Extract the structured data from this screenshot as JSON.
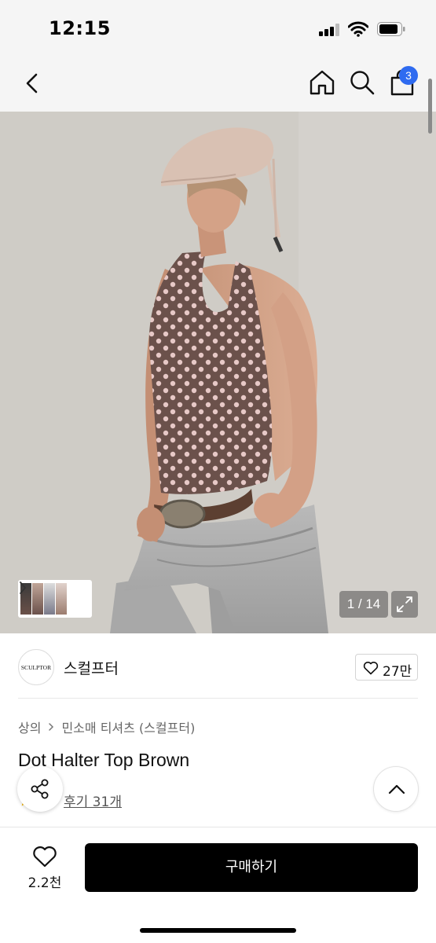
{
  "status_bar": {
    "time": "12:15"
  },
  "nav": {
    "cart_count": "3"
  },
  "gallery": {
    "counter": "1 / 14"
  },
  "seller": {
    "logo_text": "SCULPTOR",
    "name": "스컬프터",
    "likes": "27만"
  },
  "breadcrumb": {
    "category": "상의",
    "subcategory": "민소매 티셔츠 (스컬프터)"
  },
  "product": {
    "title": "Dot Halter Top Brown",
    "review_label": "후기 31개"
  },
  "bottom_bar": {
    "wish_count": "2.2천",
    "buy_label": "구매하기"
  },
  "colors": {
    "accent_badge": "#2f6bf0",
    "buy_button": "#000000",
    "top_brown": "#6b514b",
    "dot_pink": "#e7c9c7"
  },
  "icons": [
    "back-icon",
    "home-icon",
    "search-icon",
    "shopping-bag-icon",
    "expand-icon",
    "heart-icon",
    "chevron-right-icon",
    "share-icon",
    "chevron-up-icon",
    "star-icon"
  ]
}
